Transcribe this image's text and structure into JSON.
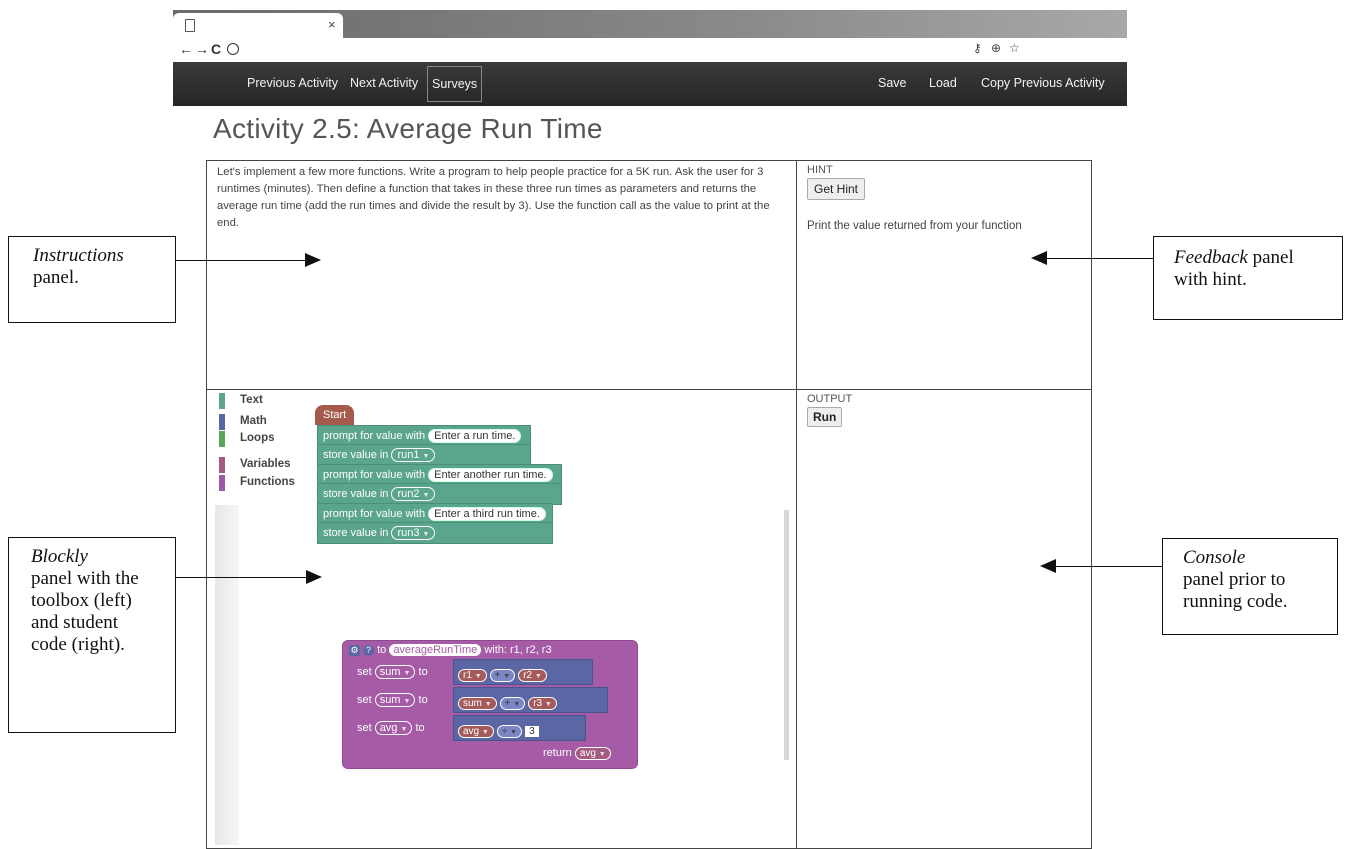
{
  "browser": {
    "back": "←",
    "forward": "→",
    "reload": "C",
    "icons": [
      "key-icon",
      "zoom-icon",
      "star-icon"
    ],
    "tab_close": "×"
  },
  "nav": {
    "previous": "Previous Activity",
    "next": "Next Activity",
    "surveys": "Surveys",
    "save": "Save",
    "load": "Load",
    "copy_previous": "Copy Previous Activity"
  },
  "page_title": "Activity 2.5: Average Run Time",
  "instructions": "Let's implement a few more functions. Write a program to help people practice for a 5K run. Ask the user for 3 runtimes (minutes). Then define a function that takes in these three run times as parameters and returns the average run time (add the run times and divide the result by 3). Use the function call as the value to print at the end.",
  "hint": {
    "label": "HINT",
    "button": "Get Hint",
    "text": "Print the value returned from your function"
  },
  "output": {
    "label": "OUTPUT",
    "button": "Run"
  },
  "toolbox": [
    {
      "label": "Text",
      "color": "#5ba58c"
    },
    {
      "label": "Math",
      "color": "#5b67a5"
    },
    {
      "label": "Loops",
      "color": "#5ba55b"
    },
    {
      "label": "Variables",
      "color": "#a55b80"
    },
    {
      "label": "Functions",
      "color": "#995ba5"
    }
  ],
  "blocks": {
    "start": "Start",
    "prompt_label": "prompt for value with",
    "store_label": "store value in",
    "prompts": [
      "Enter a run time.",
      "Enter another run time.",
      "Enter a third run time."
    ],
    "vars": [
      "run1",
      "run2",
      "run3"
    ],
    "function": {
      "to": "to",
      "name": "averageRunTime",
      "with": "with: r1, r2, r3",
      "set": "set",
      "to_label": "to",
      "rows": [
        {
          "target": "sum",
          "left": "r1",
          "op": "+",
          "right": "r2"
        },
        {
          "target": "sum",
          "left": "sum",
          "op": "+",
          "right": "r3"
        },
        {
          "target": "avg",
          "left": "avg",
          "op": "÷",
          "right": "3"
        }
      ],
      "return_label": "return",
      "return_var": "avg"
    }
  },
  "annotations": {
    "instructions": {
      "title": "Instructions",
      "rest": "panel."
    },
    "feedback": {
      "title": "Feedback",
      "rest": "panel with hint."
    },
    "blockly": {
      "title": "Blockly",
      "rest": "panel with the toolbox (left) and student code (right)."
    },
    "console": {
      "title": "Console",
      "rest": "panel prior to running code."
    }
  }
}
